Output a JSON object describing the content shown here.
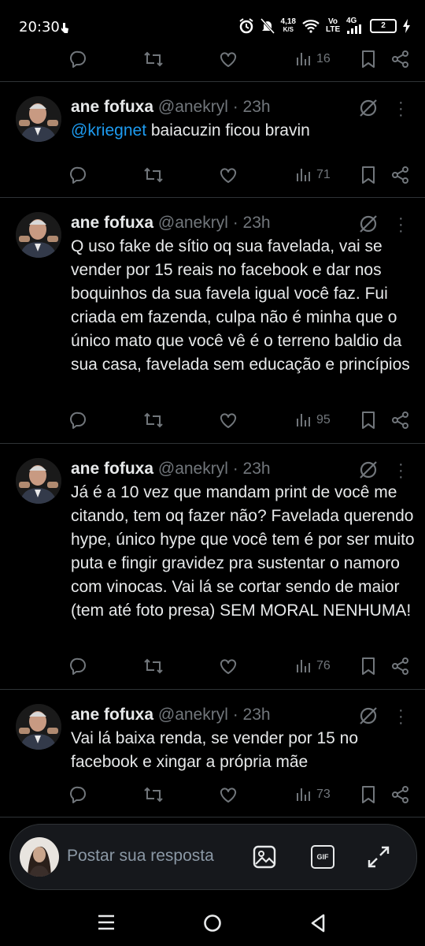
{
  "status": {
    "time": "20:30",
    "speed_value": "4,18",
    "speed_unit": "K/S",
    "volte": "Vo LTE",
    "net": "4G",
    "battery": "2"
  },
  "top_stats": {
    "views": "16"
  },
  "tweets": [
    {
      "name": "ane fofuxa",
      "handle": "@anekryl",
      "time": "· 23h",
      "mention": "@kriegnet",
      "text": " baiacuzin ficou bravin",
      "views": "71"
    },
    {
      "name": "ane fofuxa",
      "handle": "@anekryl",
      "time": "· 23h",
      "text": "Q uso fake de sítio oq sua favelada, vai se vender por 15 reais no facebook e dar nos boquinhos da sua favela igual você faz. Fui criada em fazenda, culpa não é minha que o único mato que você vê é o terreno baldio da sua casa, favelada sem educação e princípios",
      "views": "95"
    },
    {
      "name": "ane fofuxa",
      "handle": "@anekryl",
      "time": "· 23h",
      "text": "Já é a 10 vez que mandam print de você me citando, tem oq fazer não? Favelada querendo hype, único hype que você tem é por ser muito puta e fingir gravidez pra sustentar o namoro com vinocas. Vai lá se cortar sendo de maior (tem até foto presa) SEM MORAL NENHUMA!",
      "views": "76"
    },
    {
      "name": "ane fofuxa",
      "handle": "@anekryl",
      "time": "· 23h",
      "text": "Vai lá baixa renda, se vender por 15 no facebook e xingar a própria mãe",
      "views": "73"
    }
  ],
  "reply": {
    "placeholder": "Postar sua resposta",
    "gif_label": "GIF"
  },
  "colors": {
    "background": "#000000",
    "text": "#e7e9ea",
    "muted": "#71767b",
    "accent": "#1d9bf0",
    "divider": "#2f3336"
  }
}
